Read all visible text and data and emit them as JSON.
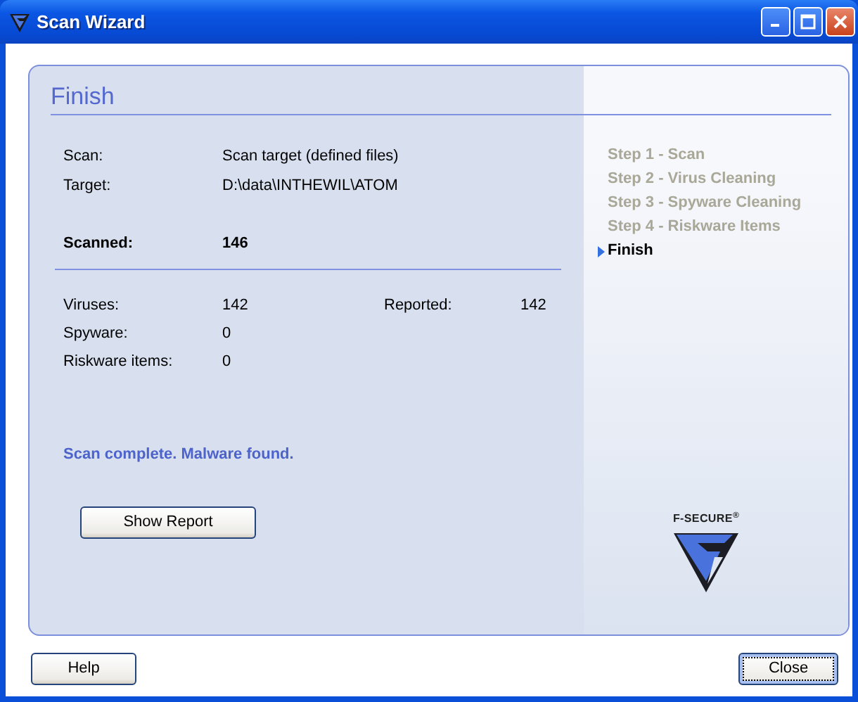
{
  "window": {
    "title": "Scan Wizard"
  },
  "header": "Finish",
  "summary": [
    {
      "label": "Scan:",
      "value": "Scan target (defined files)"
    },
    {
      "label": "Target:",
      "value": "D:\\data\\INTHEWIL\\ATOM"
    }
  ],
  "scanned": {
    "label": "Scanned:",
    "value": "146"
  },
  "results": [
    {
      "label": "Viruses:",
      "value": "142",
      "extra_label": "Reported:",
      "extra_value": "142"
    },
    {
      "label": "Spyware:",
      "value": "0"
    },
    {
      "label": "Riskware items:",
      "value": "0"
    }
  ],
  "status": "Scan complete. Malware found.",
  "report_button": {
    "label": "Show Report"
  },
  "steps": [
    {
      "label": "Step 1 - Scan",
      "selected": false
    },
    {
      "label": "Step 2 - Virus Cleaning",
      "selected": false
    },
    {
      "label": "Step 3 - Spyware Cleaning",
      "selected": false
    },
    {
      "label": "Step 4 - Riskware Items",
      "selected": false
    },
    {
      "label": "Finish",
      "selected": true
    }
  ],
  "logo": {
    "text": "F-SECURE$^{®}$"
  },
  "footer_buttons": [
    {
      "label": "Help",
      "focused": false
    },
    {
      "label": "Close",
      "focused": true
    }
  ]
}
